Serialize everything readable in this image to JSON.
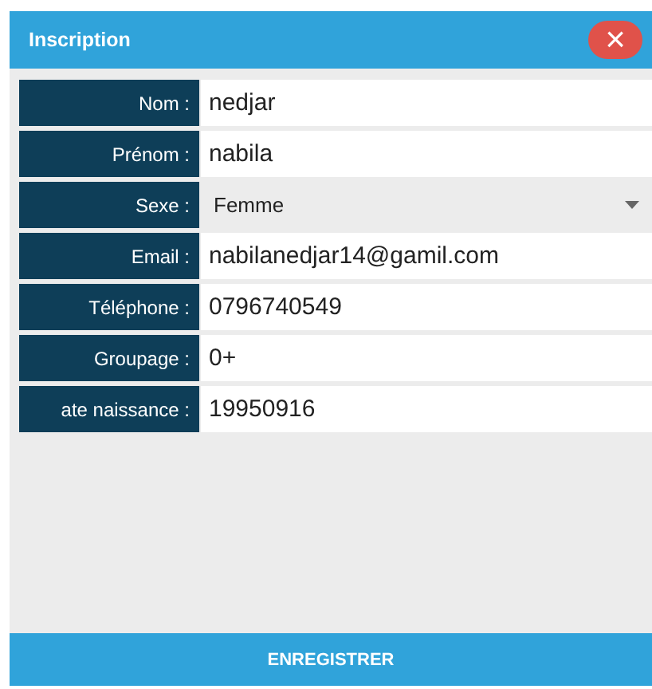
{
  "dialog": {
    "title": "Inscription",
    "close": "×"
  },
  "fields": [
    {
      "label": "Nom :",
      "kind": "text",
      "value": "nedjar"
    },
    {
      "label": "Prénom :",
      "kind": "text",
      "value": "nabila"
    },
    {
      "label": "Sexe :",
      "kind": "select",
      "value": "Femme"
    },
    {
      "label": "Email :",
      "kind": "text",
      "value": "nabilanedjar14@gamil.com"
    },
    {
      "label": "Téléphone :",
      "kind": "text",
      "value": "0796740549"
    },
    {
      "label": "Groupage :",
      "kind": "text",
      "value": "0+"
    },
    {
      "label": "ate naissance :",
      "kind": "text",
      "value": "19950916"
    }
  ],
  "submit": "ENREGISTRER"
}
